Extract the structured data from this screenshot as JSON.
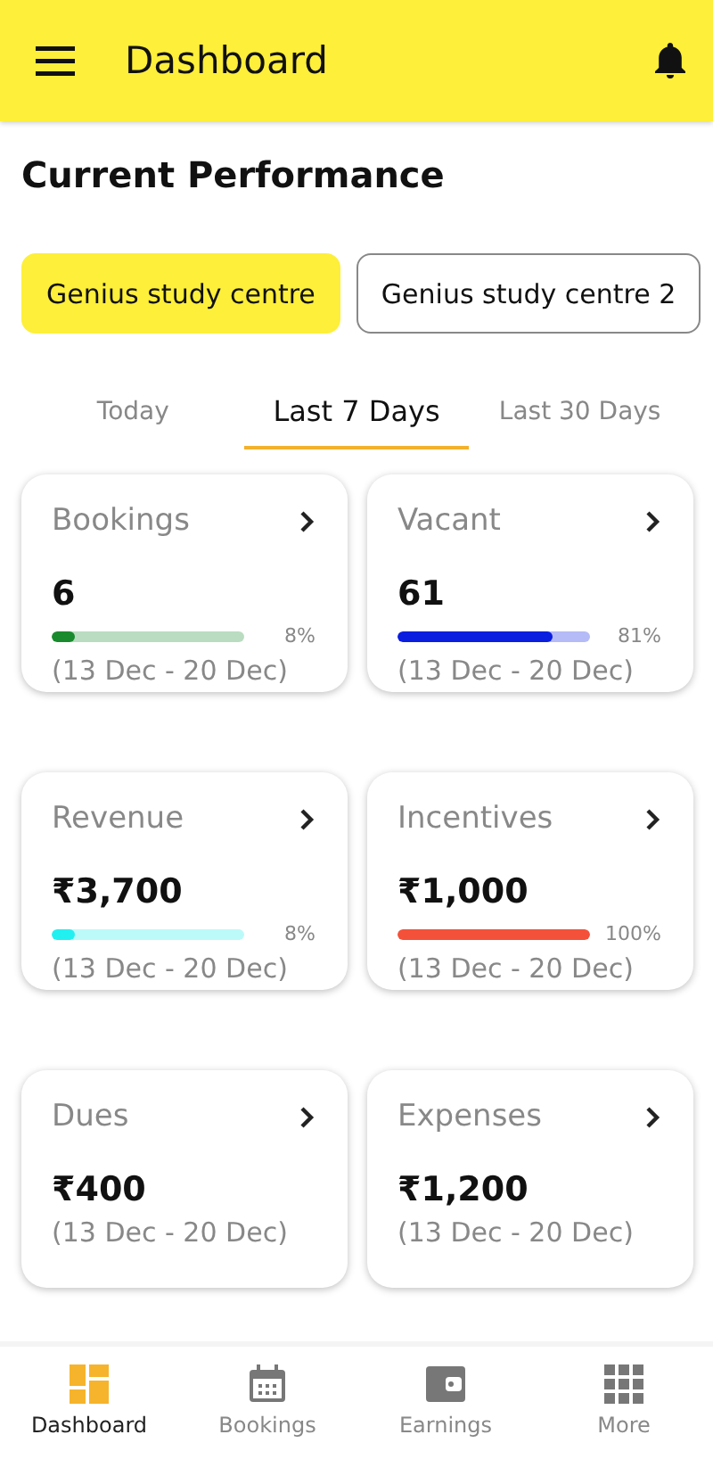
{
  "header": {
    "title": "Dashboard"
  },
  "section_title": "Current Performance",
  "centres": [
    {
      "label": "Genius study centre",
      "selected": true
    },
    {
      "label": "Genius study centre 2",
      "selected": false
    }
  ],
  "periods": [
    {
      "label": "Today",
      "selected": false
    },
    {
      "label": "Last 7 Days",
      "selected": true
    },
    {
      "label": "Last 30 Days",
      "selected": false
    }
  ],
  "cards": [
    {
      "kind": "progress",
      "title": "Bookings",
      "value": "6",
      "level": 0.08,
      "percent": "8%",
      "color": "#1a8a2e",
      "range": "(13 Dec - 20 Dec)"
    },
    {
      "kind": "progress",
      "title": "Vacant",
      "value": "61",
      "level": 0.81,
      "percent": "81%",
      "color": "#0a1ee0",
      "range": "(13 Dec - 20 Dec)"
    },
    {
      "kind": "progress",
      "title": "Revenue",
      "value": "₹3,700",
      "level": 0.08,
      "percent": "8%",
      "color": "#22f0f0",
      "range": "(13 Dec - 20 Dec)"
    },
    {
      "kind": "progress",
      "title": "Incentives",
      "value": "₹1,000",
      "level": 1,
      "percent": "100%",
      "color": "#f4513a",
      "range": "(13 Dec - 20 Dec)"
    },
    {
      "kind": "plain",
      "title": "Dues",
      "value": "₹400",
      "range": "(13 Dec - 20 Dec)"
    },
    {
      "kind": "plain",
      "title": "Expenses",
      "value": "₹1,200",
      "range": "(13 Dec - 20 Dec)"
    }
  ],
  "nav": [
    {
      "kind": "dashboard",
      "label": "Dashboard",
      "selected": true
    },
    {
      "kind": "bookings",
      "label": "Bookings",
      "selected": false
    },
    {
      "kind": "earnings",
      "label": "Earnings",
      "selected": false
    },
    {
      "kind": "more",
      "label": "More",
      "selected": false
    }
  ]
}
